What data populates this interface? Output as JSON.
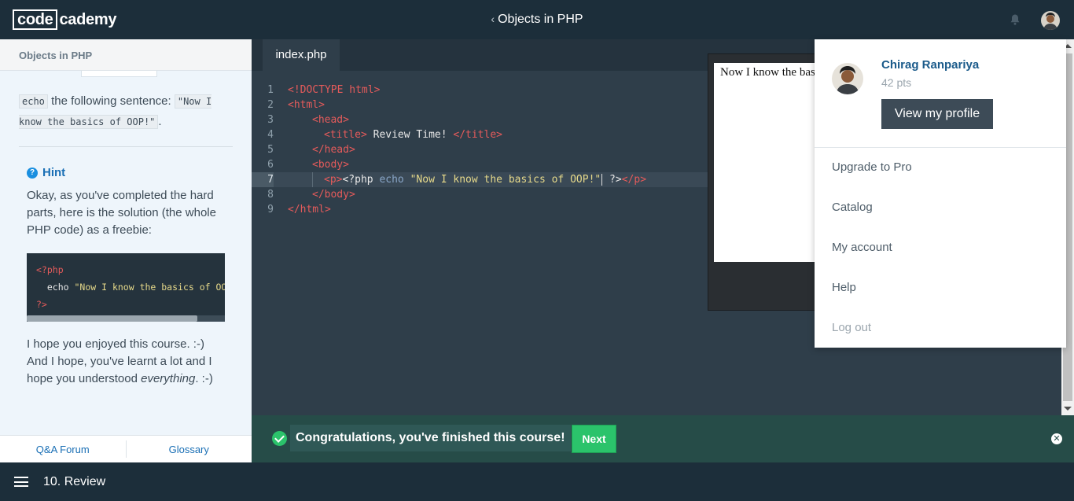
{
  "header": {
    "logo_box": "code",
    "logo_rest": "cademy",
    "course_title": "Objects in PHP"
  },
  "left_panel": {
    "section_title": "Objects in PHP",
    "instruction_code": "echo",
    "instruction_text": " the following sentence: ",
    "instruction_sentence": "\"Now I know the basics of OOP!\"",
    "instruction_end": ".",
    "hint_title": "Hint",
    "hint_text": "Okay, as you've completed the hard parts, here is the solution (the whole PHP code) as a freebie:",
    "hint_code_line1": "<?php",
    "hint_code_line2_kw": "echo ",
    "hint_code_line2_str": "\"Now I know the basics of OOP!\";",
    "hint_code_line3": "?>",
    "outro_text_1": "I hope you enjoyed this course. :-) And I hope, you've learnt a lot and I hope you understood ",
    "outro_emph": "everything",
    "outro_text_2": ". :-)",
    "footer_qa": "Q&A Forum",
    "footer_glossary": "Glossary"
  },
  "editor": {
    "tab_label": "index.php",
    "lines": [
      {
        "num": "1",
        "text": "<!DOCTYPE html>"
      },
      {
        "num": "2",
        "text": "<html>"
      },
      {
        "num": "3",
        "text": "<head>"
      },
      {
        "num": "4",
        "open": "<title>",
        "mid": " Review Time! ",
        "close": "</title>"
      },
      {
        "num": "5",
        "text": "</head>"
      },
      {
        "num": "6",
        "text": "<body>"
      },
      {
        "num": "7",
        "open": "<p>",
        "php": "<?php ",
        "kw": "echo ",
        "str": "\"Now I know the basics of OOP!\"",
        "end": " ?>",
        "close": "</p>"
      },
      {
        "num": "8",
        "text": "</body>"
      },
      {
        "num": "9",
        "text": "</html>"
      }
    ],
    "active_line": 7
  },
  "preview": {
    "text": "Now I know the basics of OOP!"
  },
  "profile_menu": {
    "name": "Chirag Ranpariya",
    "points": "42 pts",
    "view_profile": "View my profile",
    "items": [
      "Upgrade to Pro",
      "Catalog",
      "My account",
      "Help",
      "Log out"
    ]
  },
  "banner": {
    "message": "Congratulations, you've finished this course!",
    "next_label": "Next",
    "close_glyph": "✕"
  },
  "footer": {
    "lesson": "10. Review"
  },
  "colors": {
    "navbar": "#1c2e3a",
    "editor_bg": "#2f3e4a",
    "accent_green": "#2bc36b",
    "link_blue": "#1a6fb5",
    "banner_bg": "#264c48"
  },
  "icons": [
    "chevron-left-icon",
    "bell-icon",
    "user-avatar",
    "hint-question-icon",
    "check-circle-icon",
    "close-icon",
    "hamburger-menu-icon"
  ]
}
